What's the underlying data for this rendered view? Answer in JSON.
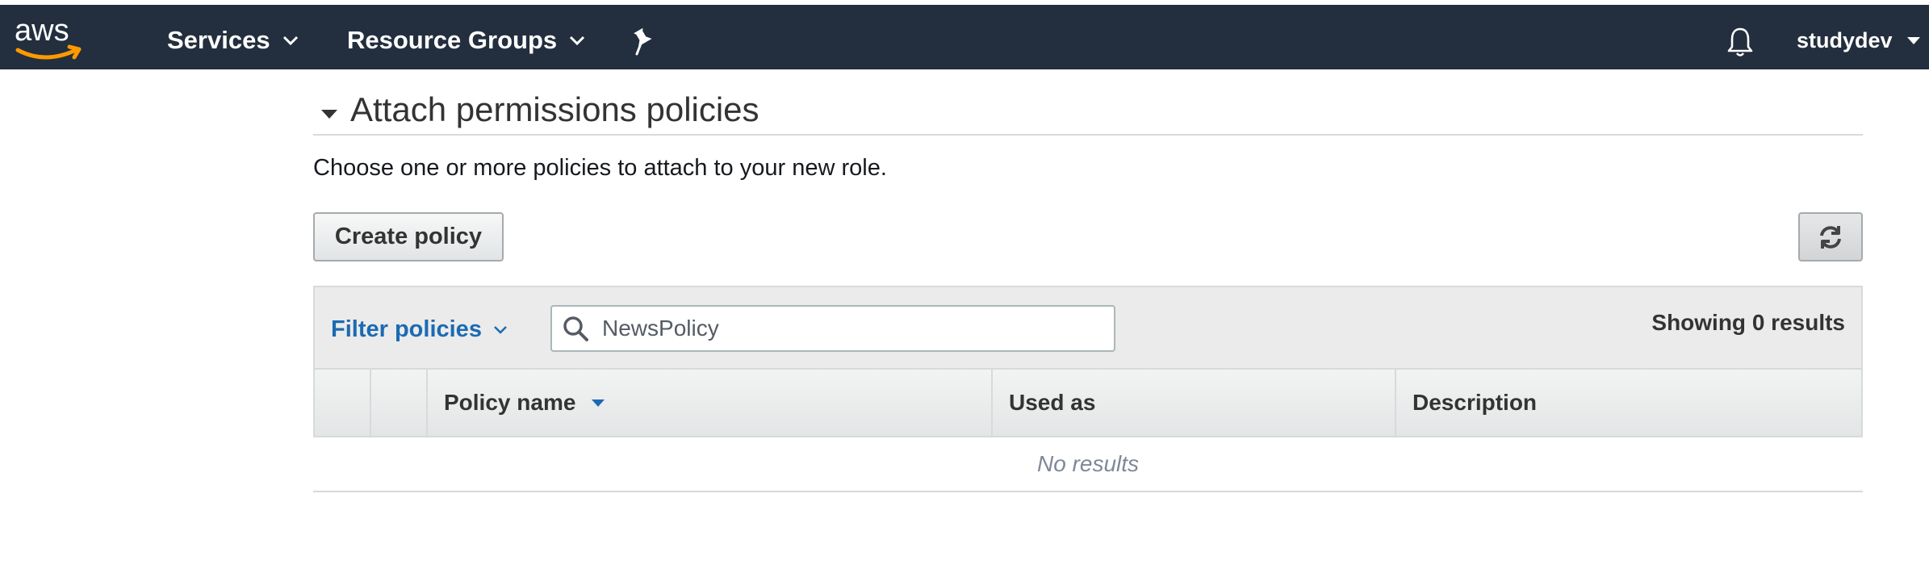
{
  "nav": {
    "logo_text": "aws",
    "services_label": "Services",
    "resource_groups_label": "Resource Groups",
    "username": "studydev"
  },
  "section": {
    "title": "Attach permissions policies",
    "subtitle": "Choose one or more policies to attach to your new role."
  },
  "toolbar": {
    "create_policy_label": "Create policy"
  },
  "filter": {
    "label": "Filter policies",
    "search_value": "NewsPolicy",
    "results_text": "Showing 0 results"
  },
  "table": {
    "columns": [
      "Policy name",
      "Used as",
      "Description"
    ],
    "empty_text": "No results"
  },
  "colors": {
    "nav_bg": "#232f3e",
    "aws_orange": "#ff9900",
    "link_blue": "#1c6ab3"
  },
  "icons": [
    "aws-logo",
    "chevron-down-icon",
    "pin-icon",
    "bell-icon",
    "caret-down-icon",
    "refresh-icon",
    "search-icon",
    "sort-desc-icon"
  ]
}
